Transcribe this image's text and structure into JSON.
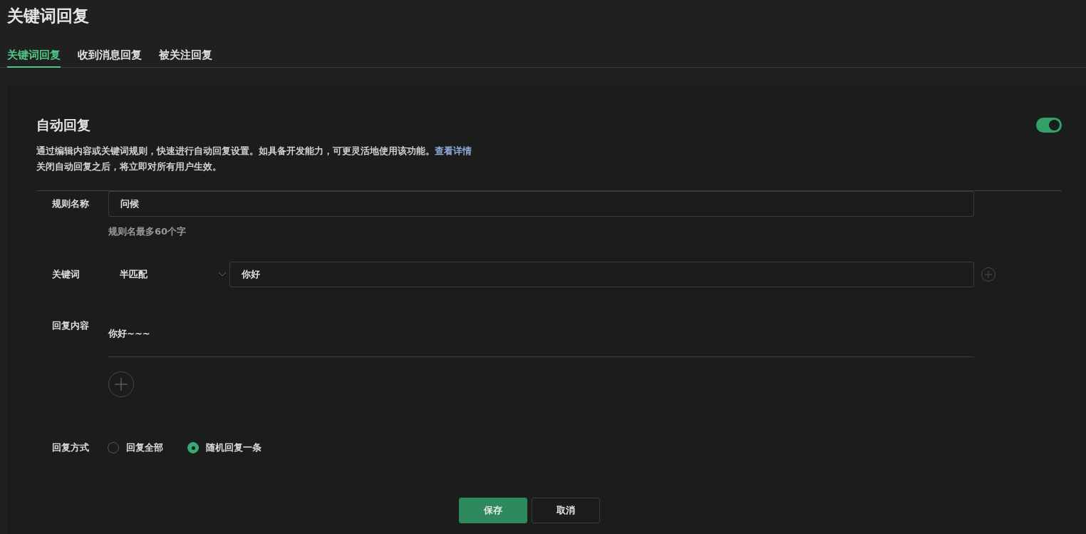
{
  "page_title": "关键词回复",
  "tabs": [
    {
      "label": "关键词回复",
      "selected": true
    },
    {
      "label": "收到消息回复",
      "selected": false
    },
    {
      "label": "被关注回复",
      "selected": false
    }
  ],
  "auto_reply": {
    "title": "自动回复",
    "on": true,
    "description": "通过编辑内容或关键词规则，快速进行自动回复设置。如具备开发能力，可更灵活地使用该功能。",
    "details_link": "查看详情",
    "note": "关闭自动回复之后，将立即对所有用户生效。"
  },
  "rule_name": {
    "label": "规则名称",
    "value": "问候",
    "hint": "规则名最多60个字"
  },
  "keyword": {
    "label": "关键词",
    "match_mode": "半匹配",
    "value": "你好"
  },
  "reply_content": {
    "label": "回复内容",
    "value": "你好~~~"
  },
  "reply_mode": {
    "label": "回复方式",
    "options": [
      {
        "label": "回复全部",
        "selected": false
      },
      {
        "label": "随机回复一条",
        "selected": true
      }
    ]
  },
  "buttons": [
    {
      "label": "保存",
      "kind": "primary"
    },
    {
      "label": "取消",
      "kind": "secondary"
    }
  ]
}
